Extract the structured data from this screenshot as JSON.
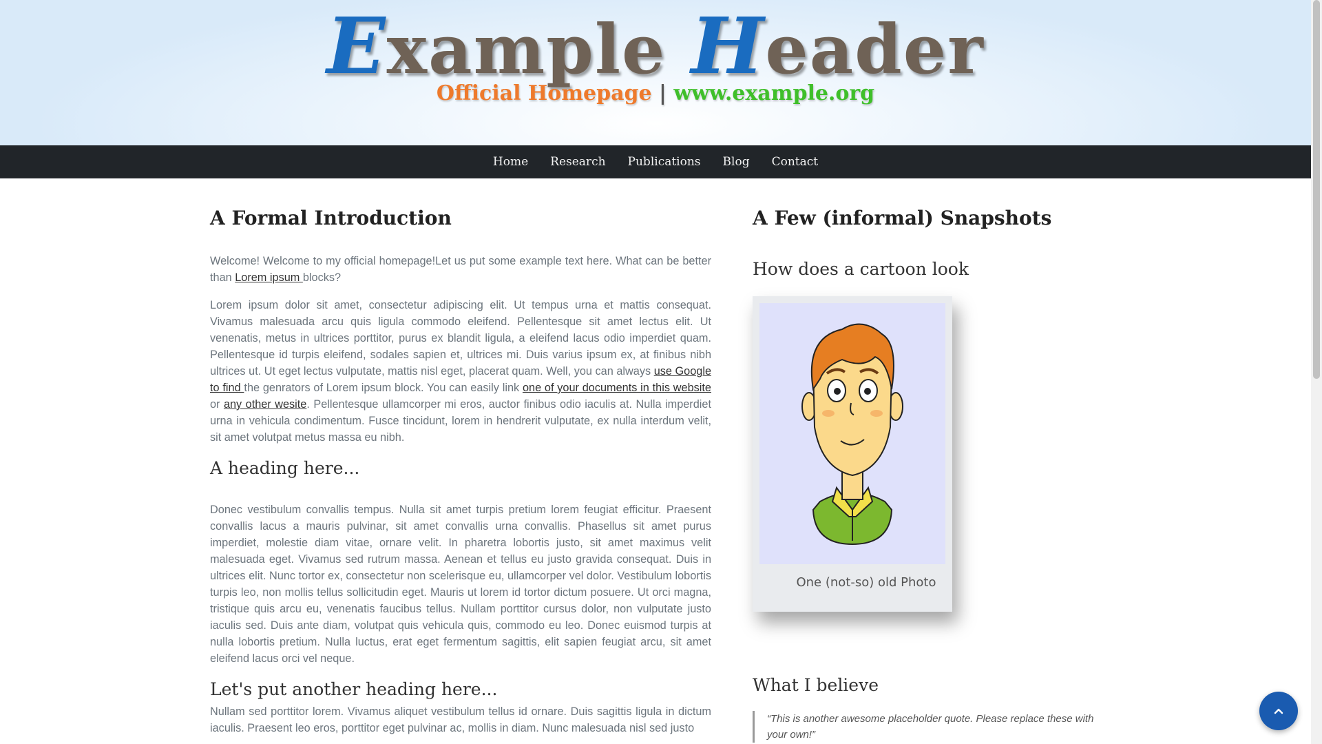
{
  "header": {
    "title_cap1": "E",
    "title_rest1": "xample ",
    "title_cap2": "H",
    "title_rest2": "eader",
    "subtitle_left": "Official Homepage",
    "subtitle_sep": "|",
    "subtitle_right": "www.example.org"
  },
  "nav": {
    "items": [
      {
        "label": "Home"
      },
      {
        "label": "Research"
      },
      {
        "label": "Publications"
      },
      {
        "label": "Blog"
      },
      {
        "label": "Contact"
      }
    ]
  },
  "left": {
    "title": "A Formal Introduction",
    "intro_text": "Welcome! Welcome to my official homepage!Let us put some example text here. What can be better than ",
    "intro_link": "Lorem ipsum ",
    "intro_tail": "blocks?",
    "p2_a": "Lorem ipsum dolor sit amet, consectetur adipiscing elit. Ut tempus urna et mattis consequat. Vivamus malesuada arcu quis ligula commodo eleifend. Pellentesque sit amet lectus elit. Ut venenatis, metus in ultrices porttitor, purus ex blandit ligula, a eleifend lacus odio imperdiet quam. Pellentesque id turpis eleifend, sodales sapien et, ultrices mi. Duis varius ipsum ex, at finibus nibh ultrices ut. Ut eget lectus vulputate, mattis nisl eget, placerat quam. Well, you can always ",
    "p2_link1": "use Google to find ",
    "p2_b": "the genrators of Lorem ipsum block. You can easily link ",
    "p2_link2": "one of your documents in this website",
    "p2_c": " or ",
    "p2_link3": "any other wesite",
    "p2_d": ". Pellentesque ullamcorper mi eros, auctor finibus odio iaculis at. Nulla imperdiet urna in vehicula condimentum. Fusce tincidunt, lorem in hendrerit vulputate, ex nulla interdum velit, sit amet volutpat metus massa eu nibh.",
    "heading2": "A heading here...",
    "p3": "Donec vestibulum convallis tempus. Nulla sit amet turpis pretium lorem feugiat efficitur. Praesent convallis lacus a mauris pulvinar, sit amet convallis urna convallis. Phasellus sit amet purus imperdiet, molestie diam vitae, ornare velit. In pharetra lobortis justo, sit amet maximus velit malesuada eget. Vivamus sed rutrum massa. Aenean et tellus eu justo gravida consequat. Duis in ultrices elit. Nunc tortor ex, consectetur non scelerisque eu, ullamcorper vel dolor. Vestibulum lobortis turpis leo, non mollis tellus sollicitudin eget. Mauris ut lorem id tortor dictum posuere. Ut orci magna, tristique quis arcu eu, venenatis faucibus tellus. Nullam porttitor cursus dolor, non vulputate justo iaculis sed. Duis ante diam, volutpat quis vehicula quis, commodo eu leo. Donec euismod turpis at nulla lobortis pretium. Nulla luctus, erat eget fermentum sagittis, elit sapien feugiat arcu, sit amet eleifend lacus orci vel neque.",
    "heading3": "Let's put another heading here...",
    "p4": "Nullam sed porttitor lorem. Vivamus aliquet vestibulum tellus id ornare. Duis sagittis ligula in dictum iaculis. Praesent leo eros, porttitor eget pulvinar ac, mollis in diam. Nunc malesuada nisl sed justo"
  },
  "right": {
    "title": "A Few (informal) Snapshots",
    "cartoon_heading": "How does a cartoon look",
    "photo_caption": "One (not-so) old Photo",
    "believe_heading": "What I believe",
    "quote": "“This is another awesome placeholder quote. Please replace these with your own!”"
  },
  "colors": {
    "nav_bg": "#212529",
    "title_accent": "#1a6cc0",
    "subtitle_orange": "#ee7a2c",
    "subtitle_green": "#3fbf2a",
    "back_to_top": "#1a5bb0"
  },
  "icons": {
    "back_to_top": "chevron-up-icon"
  }
}
